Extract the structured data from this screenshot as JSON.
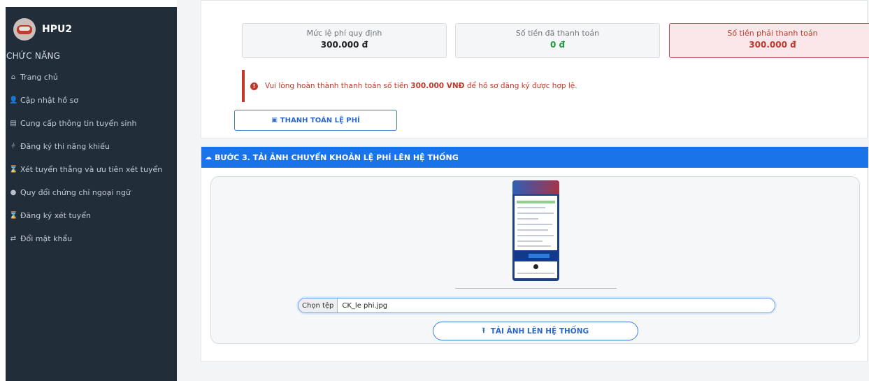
{
  "sidebar": {
    "brand": "HPU2",
    "heading": "CHỨC NĂNG",
    "items": [
      {
        "icon": "home-icon",
        "glyph": "⌂",
        "label": "Trang chủ"
      },
      {
        "icon": "user-edit-icon",
        "glyph": "👤",
        "label": "Cập nhật hồ sơ"
      },
      {
        "icon": "id-card-icon",
        "glyph": "▤",
        "label": "Cung cấp thông tin tuyển sinh"
      },
      {
        "icon": "dumbbell-icon",
        "glyph": "⫩",
        "label": "Đăng ký thi năng khiếu"
      },
      {
        "icon": "hourglass-icon",
        "glyph": "⌛",
        "label": "Xét tuyển thẳng và ưu tiên xét tuyển"
      },
      {
        "icon": "circle-icon",
        "glyph": "●",
        "label": "Quy đổi chứng chỉ ngoại ngữ"
      },
      {
        "icon": "hourglass-icon",
        "glyph": "⌛",
        "label": "Đăng ký xét tuyển"
      },
      {
        "icon": "exchange-icon",
        "glyph": "⇄",
        "label": "Đổi mật khẩu"
      }
    ]
  },
  "fees": {
    "regulated_label": "Mức lệ phí quy định",
    "regulated_value": "300.000 đ",
    "paid_label": "Số tiền đã thanh toán",
    "paid_value": "0 đ",
    "due_label": "Số tiền phải thanh toán",
    "due_value": "300.000 đ"
  },
  "alert": {
    "prefix": "Vui lòng hoàn thành thanh toán số tiền ",
    "amount": "300.000 VNĐ",
    "suffix": " để hồ sơ đăng ký được hợp lệ."
  },
  "pay_button": "THANH TOÁN LỆ PHÍ",
  "step3": {
    "title": "BƯỚC 3. TẢI ẢNH CHUYỂN KHOẢN LỆ PHÍ LÊN HỆ THỐNG",
    "file_button": "Chọn tệp",
    "file_name": "CK_le phi.jpg",
    "upload_button": "TẢI ẢNH LÊN HỆ THỐNG"
  },
  "colors": {
    "sidebar_bg": "#222d3a",
    "accent": "#1a73e8",
    "danger": "#c0392b",
    "success": "#1e9b3e"
  }
}
